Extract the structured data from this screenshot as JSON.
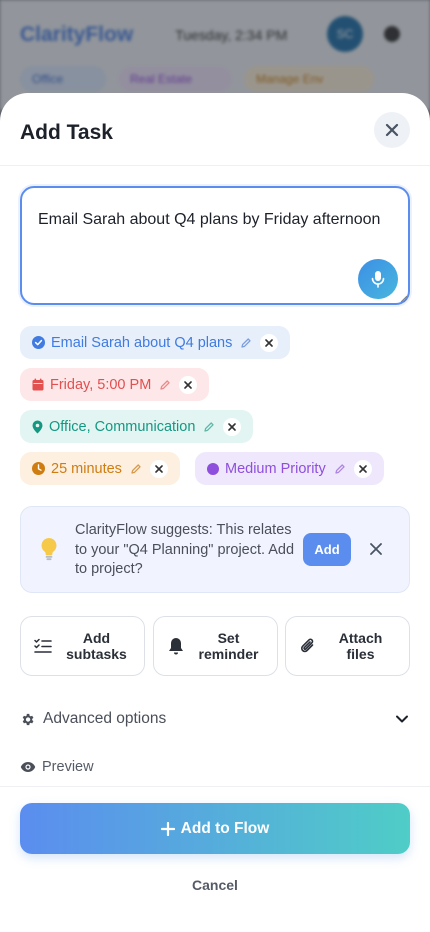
{
  "background_app": {
    "logo": "ClarityFlow",
    "date": "Tuesday, 2:34 PM",
    "avatar_initials": "SC",
    "filters": [
      "Office",
      "Real Estate",
      "Manage Env"
    ]
  },
  "sheet": {
    "title": "Add Task",
    "close_icon": "close-icon"
  },
  "task_input": {
    "value": "Email Sarah about Q4 plans by Friday afternoon",
    "mic_icon": "microphone-icon"
  },
  "parsed_chips": {
    "title": "Email Sarah about Q4 plans",
    "date": "Friday, 5:00 PM",
    "location": "Office, Communication",
    "duration": "25 minutes",
    "priority": "Medium Priority"
  },
  "suggestion": {
    "text": "ClarityFlow suggests: This relates to your \"Q4 Planning\" project. Add to project?",
    "add_label": "Add"
  },
  "actions": [
    {
      "label": "Add subtasks",
      "icon": "checklist-icon"
    },
    {
      "label": "Set reminder",
      "icon": "bell-icon"
    },
    {
      "label": "Attach files",
      "icon": "paperclip-icon"
    }
  ],
  "advanced": {
    "label": "Advanced options",
    "icon": "gear-icon"
  },
  "preview": {
    "label": "Preview",
    "icon": "eye-icon"
  },
  "footer": {
    "primary_label": "Add to Flow",
    "cancel_label": "Cancel"
  },
  "colors": {
    "accent": "#5b8def",
    "teal": "#4fcdc7",
    "date_red": "#e2504f",
    "location_green": "#159882",
    "duration_orange": "#cf7c11",
    "priority_purple": "#8e4fdd"
  }
}
